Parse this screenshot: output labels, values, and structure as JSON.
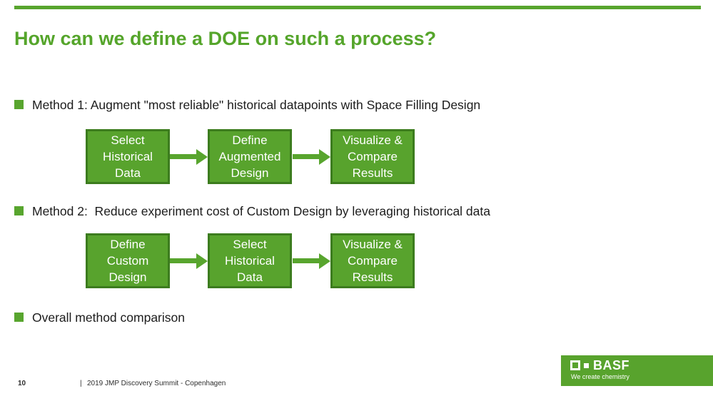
{
  "slide": {
    "title": "How can we define a DOE on such a process?",
    "bullets": [
      {
        "label": "Method 1: Augment \"most reliable\" historical datapoints with Space Filling Design"
      },
      {
        "label": "Method 2:  Reduce experiment cost of Custom Design by leveraging historical data"
      },
      {
        "label": "Overall method comparison"
      }
    ],
    "flowcharts": [
      {
        "steps": [
          {
            "lines": [
              "Select",
              "Historical",
              "Data"
            ]
          },
          {
            "lines": [
              "Define",
              "Augmented",
              "Design"
            ]
          },
          {
            "lines": [
              "Visualize &",
              "Compare",
              "Results"
            ]
          }
        ]
      },
      {
        "steps": [
          {
            "lines": [
              "Define",
              "Custom",
              "Design"
            ]
          },
          {
            "lines": [
              "Select",
              "Historical",
              "Data"
            ]
          },
          {
            "lines": [
              "Visualize &",
              "Compare",
              "Results"
            ]
          }
        ]
      }
    ],
    "footer": {
      "page_number": "10",
      "separator": "|",
      "event": "2019 JMP Discovery Summit - Copenhagen"
    },
    "logo": {
      "brand": "BASF",
      "tagline": "We create chemistry"
    },
    "colors": {
      "brand_green": "#58a52e",
      "title_green": "#55a52b",
      "box_fill": "#58a32d",
      "box_border": "#3c7c1e",
      "text_dark": "#1c1c1c",
      "footer_text": "#2e2e2e"
    }
  }
}
